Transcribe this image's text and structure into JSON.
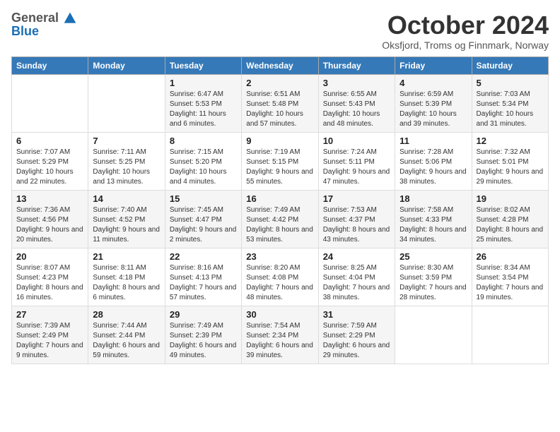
{
  "header": {
    "logo_general": "General",
    "logo_blue": "Blue",
    "month_title": "October 2024",
    "subtitle": "Oksfjord, Troms og Finnmark, Norway"
  },
  "weekdays": [
    "Sunday",
    "Monday",
    "Tuesday",
    "Wednesday",
    "Thursday",
    "Friday",
    "Saturday"
  ],
  "weeks": [
    [
      {
        "day": "",
        "info": ""
      },
      {
        "day": "",
        "info": ""
      },
      {
        "day": "1",
        "info": "Sunrise: 6:47 AM\nSunset: 5:53 PM\nDaylight: 11 hours and 6 minutes."
      },
      {
        "day": "2",
        "info": "Sunrise: 6:51 AM\nSunset: 5:48 PM\nDaylight: 10 hours and 57 minutes."
      },
      {
        "day": "3",
        "info": "Sunrise: 6:55 AM\nSunset: 5:43 PM\nDaylight: 10 hours and 48 minutes."
      },
      {
        "day": "4",
        "info": "Sunrise: 6:59 AM\nSunset: 5:39 PM\nDaylight: 10 hours and 39 minutes."
      },
      {
        "day": "5",
        "info": "Sunrise: 7:03 AM\nSunset: 5:34 PM\nDaylight: 10 hours and 31 minutes."
      }
    ],
    [
      {
        "day": "6",
        "info": "Sunrise: 7:07 AM\nSunset: 5:29 PM\nDaylight: 10 hours and 22 minutes."
      },
      {
        "day": "7",
        "info": "Sunrise: 7:11 AM\nSunset: 5:25 PM\nDaylight: 10 hours and 13 minutes."
      },
      {
        "day": "8",
        "info": "Sunrise: 7:15 AM\nSunset: 5:20 PM\nDaylight: 10 hours and 4 minutes."
      },
      {
        "day": "9",
        "info": "Sunrise: 7:19 AM\nSunset: 5:15 PM\nDaylight: 9 hours and 55 minutes."
      },
      {
        "day": "10",
        "info": "Sunrise: 7:24 AM\nSunset: 5:11 PM\nDaylight: 9 hours and 47 minutes."
      },
      {
        "day": "11",
        "info": "Sunrise: 7:28 AM\nSunset: 5:06 PM\nDaylight: 9 hours and 38 minutes."
      },
      {
        "day": "12",
        "info": "Sunrise: 7:32 AM\nSunset: 5:01 PM\nDaylight: 9 hours and 29 minutes."
      }
    ],
    [
      {
        "day": "13",
        "info": "Sunrise: 7:36 AM\nSunset: 4:56 PM\nDaylight: 9 hours and 20 minutes."
      },
      {
        "day": "14",
        "info": "Sunrise: 7:40 AM\nSunset: 4:52 PM\nDaylight: 9 hours and 11 minutes."
      },
      {
        "day": "15",
        "info": "Sunrise: 7:45 AM\nSunset: 4:47 PM\nDaylight: 9 hours and 2 minutes."
      },
      {
        "day": "16",
        "info": "Sunrise: 7:49 AM\nSunset: 4:42 PM\nDaylight: 8 hours and 53 minutes."
      },
      {
        "day": "17",
        "info": "Sunrise: 7:53 AM\nSunset: 4:37 PM\nDaylight: 8 hours and 43 minutes."
      },
      {
        "day": "18",
        "info": "Sunrise: 7:58 AM\nSunset: 4:33 PM\nDaylight: 8 hours and 34 minutes."
      },
      {
        "day": "19",
        "info": "Sunrise: 8:02 AM\nSunset: 4:28 PM\nDaylight: 8 hours and 25 minutes."
      }
    ],
    [
      {
        "day": "20",
        "info": "Sunrise: 8:07 AM\nSunset: 4:23 PM\nDaylight: 8 hours and 16 minutes."
      },
      {
        "day": "21",
        "info": "Sunrise: 8:11 AM\nSunset: 4:18 PM\nDaylight: 8 hours and 6 minutes."
      },
      {
        "day": "22",
        "info": "Sunrise: 8:16 AM\nSunset: 4:13 PM\nDaylight: 7 hours and 57 minutes."
      },
      {
        "day": "23",
        "info": "Sunrise: 8:20 AM\nSunset: 4:08 PM\nDaylight: 7 hours and 48 minutes."
      },
      {
        "day": "24",
        "info": "Sunrise: 8:25 AM\nSunset: 4:04 PM\nDaylight: 7 hours and 38 minutes."
      },
      {
        "day": "25",
        "info": "Sunrise: 8:30 AM\nSunset: 3:59 PM\nDaylight: 7 hours and 28 minutes."
      },
      {
        "day": "26",
        "info": "Sunrise: 8:34 AM\nSunset: 3:54 PM\nDaylight: 7 hours and 19 minutes."
      }
    ],
    [
      {
        "day": "27",
        "info": "Sunrise: 7:39 AM\nSunset: 2:49 PM\nDaylight: 7 hours and 9 minutes."
      },
      {
        "day": "28",
        "info": "Sunrise: 7:44 AM\nSunset: 2:44 PM\nDaylight: 6 hours and 59 minutes."
      },
      {
        "day": "29",
        "info": "Sunrise: 7:49 AM\nSunset: 2:39 PM\nDaylight: 6 hours and 49 minutes."
      },
      {
        "day": "30",
        "info": "Sunrise: 7:54 AM\nSunset: 2:34 PM\nDaylight: 6 hours and 39 minutes."
      },
      {
        "day": "31",
        "info": "Sunrise: 7:59 AM\nSunset: 2:29 PM\nDaylight: 6 hours and 29 minutes."
      },
      {
        "day": "",
        "info": ""
      },
      {
        "day": "",
        "info": ""
      }
    ]
  ]
}
